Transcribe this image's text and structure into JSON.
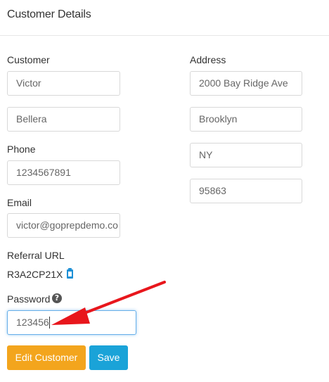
{
  "panel": {
    "title": "Customer Details"
  },
  "customer": {
    "label": "Customer",
    "first_name": "Victor",
    "last_name": "Bellera"
  },
  "phone": {
    "label": "Phone",
    "value": "1234567891"
  },
  "email": {
    "label": "Email",
    "value": "victor@goprepdemo.co"
  },
  "referral": {
    "label": "Referral URL",
    "value": "R3A2CP21X"
  },
  "password": {
    "label": "Password",
    "value": "123456"
  },
  "address": {
    "label": "Address",
    "street": "2000 Bay Ridge Ave",
    "city": "Brooklyn",
    "state": "NY",
    "zip": "95863"
  },
  "buttons": {
    "edit_label": "Edit Customer",
    "save_label": "Save"
  },
  "colors": {
    "edit_button": "#f3a51d",
    "save_button": "#1aa3d8",
    "annotation_arrow": "#e8161c",
    "focus_border": "#66afe9"
  }
}
